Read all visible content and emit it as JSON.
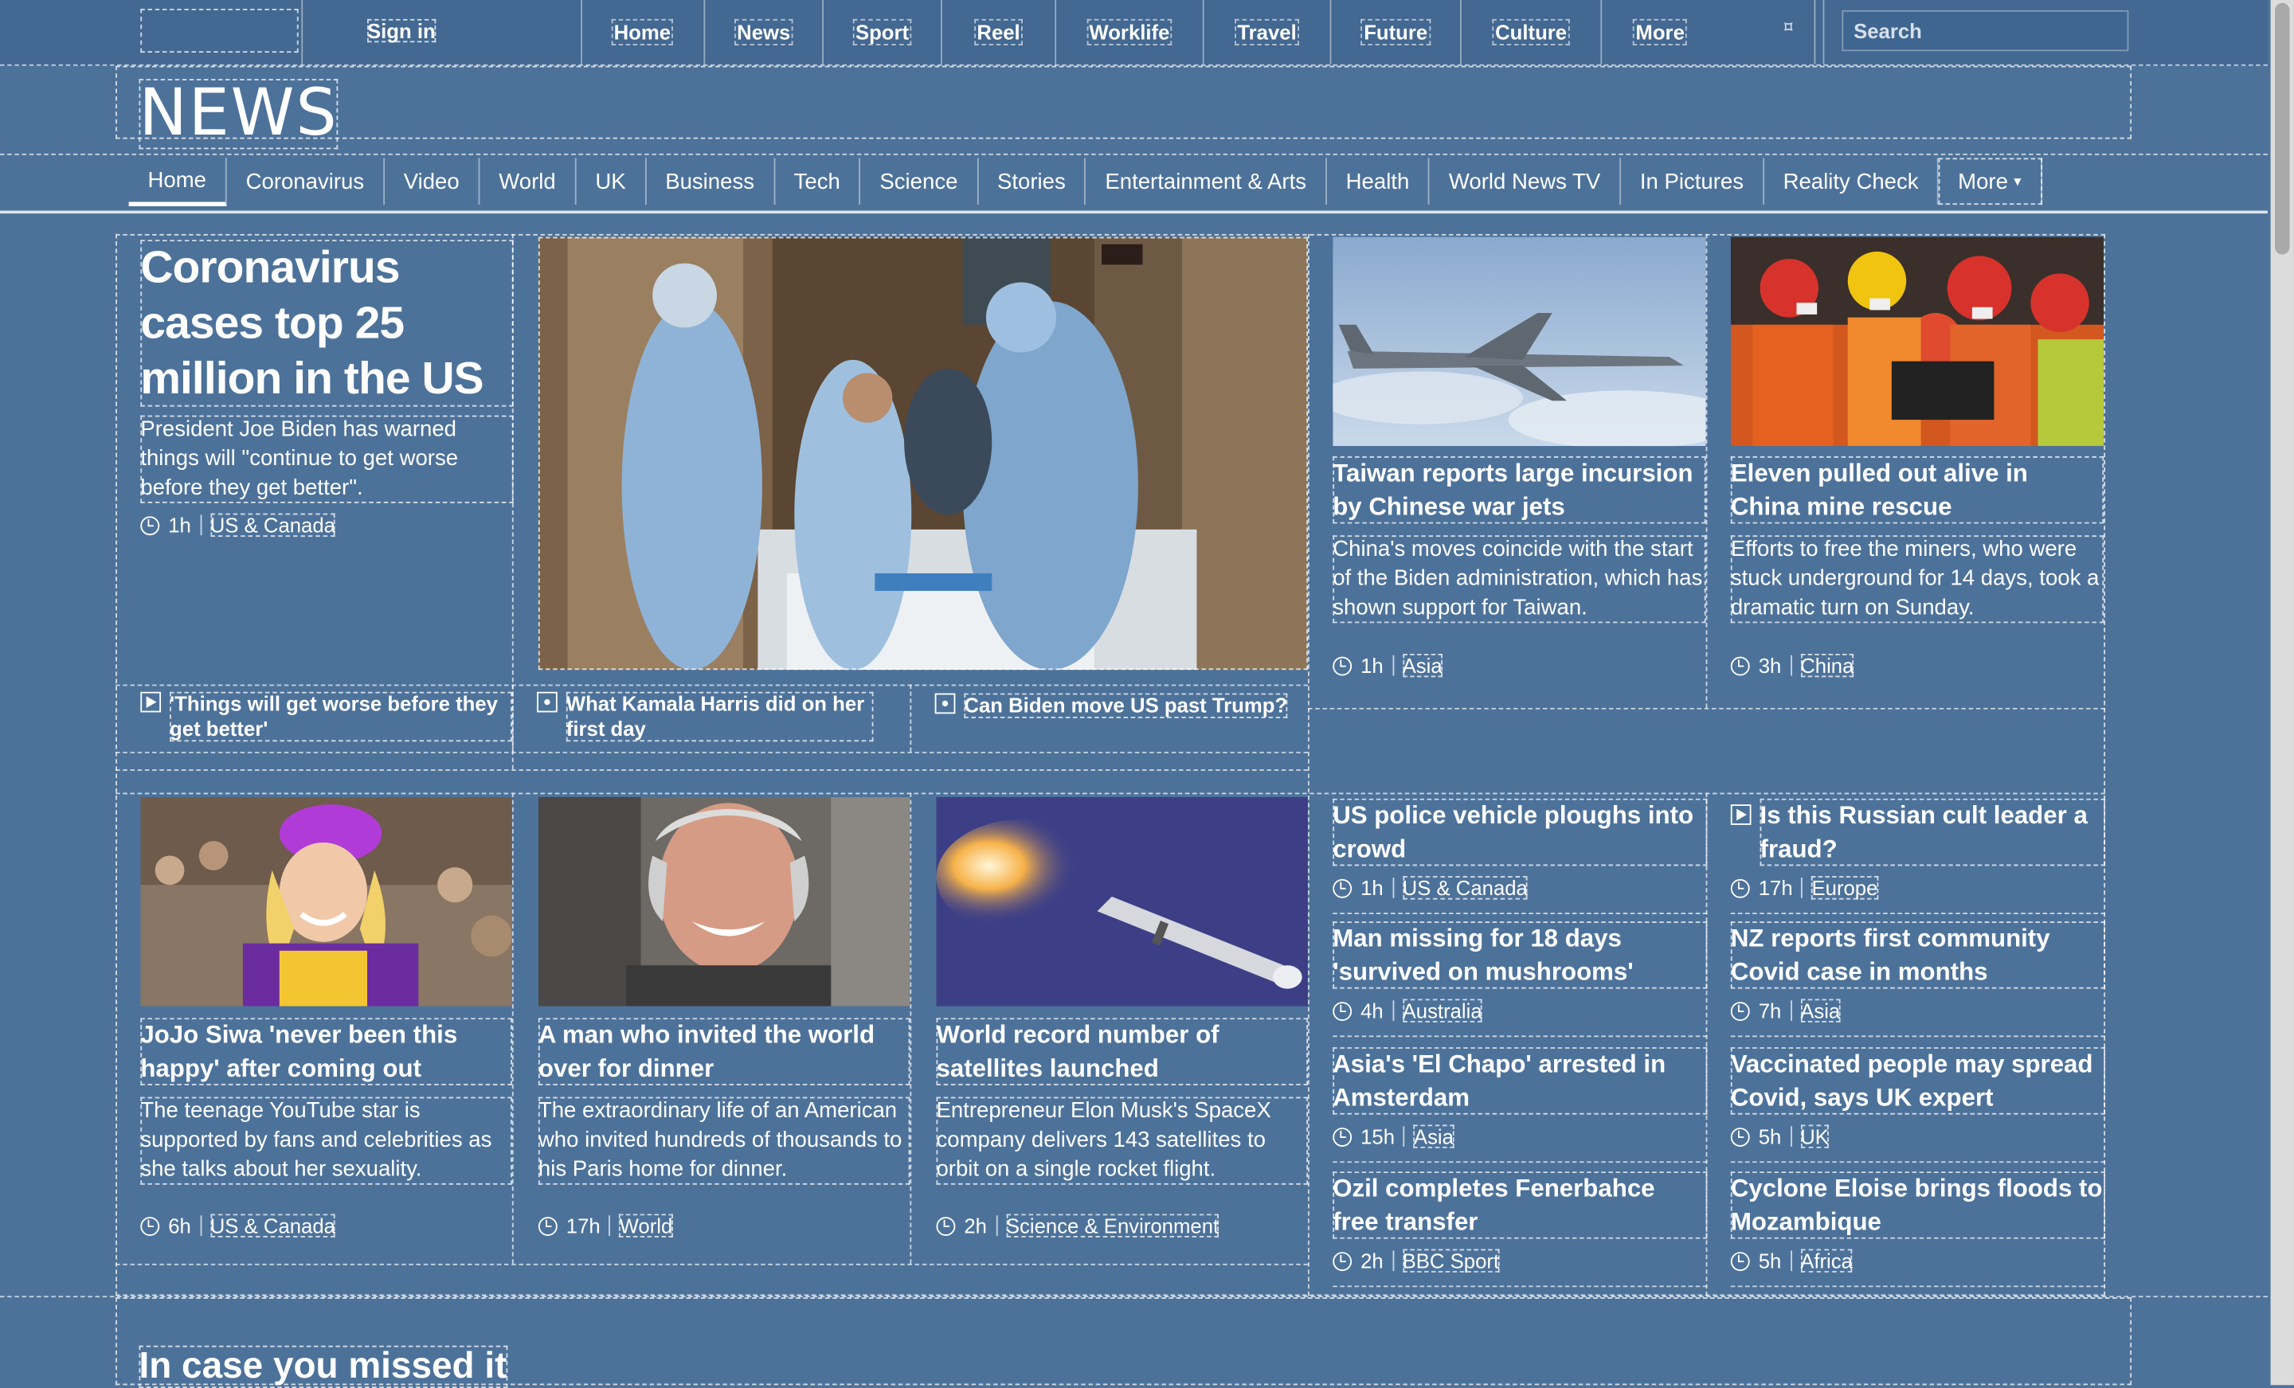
{
  "topbar": {
    "signin_label": "Sign in",
    "nav": [
      {
        "label": "Home",
        "w": 84
      },
      {
        "label": "News",
        "w": 80
      },
      {
        "label": "Sport",
        "w": 80
      },
      {
        "label": "Reel",
        "w": 77
      },
      {
        "label": "Worklife",
        "w": 100
      },
      {
        "label": "Travel",
        "w": 86
      },
      {
        "label": "Future",
        "w": 88
      },
      {
        "label": "Culture",
        "w": 95
      },
      {
        "label": "More",
        "w": 152
      }
    ],
    "search_placeholder": "Search"
  },
  "masthead": {
    "brand": "NEWS"
  },
  "secnav": {
    "items": [
      "Home",
      "Coronavirus",
      "Video",
      "World",
      "UK",
      "Business",
      "Tech",
      "Science",
      "Stories",
      "Entertainment & Arts",
      "Health",
      "World News TV",
      "In Pictures",
      "Reality Check"
    ],
    "more_label": "More"
  },
  "lead": {
    "title": "Coronavirus cases top 25 million in the US",
    "summary": "President Joe Biden has warned things will \"continue to get worse before they get better\".",
    "time": "1h",
    "section": "US & Canada",
    "related": [
      {
        "icon": "play-icon",
        "text": "'Things will get worse before they get better'"
      },
      {
        "icon": "article-icon",
        "text": "What Kamala Harris did on her first day"
      },
      {
        "icon": "article-icon",
        "text": "Can Biden move US past Trump?"
      }
    ]
  },
  "top_right": [
    {
      "title": "Taiwan reports large incursion by Chinese war jets",
      "summary": "China's moves coincide with the start of the Biden administration, which has shown support for Taiwan.",
      "time": "1h",
      "section": "Asia"
    },
    {
      "title": "Eleven pulled out alive in China mine rescue",
      "summary": "Efforts to free the miners, who were stuck underground for 14 days, took a dramatic turn on Sunday.",
      "time": "3h",
      "section": "China"
    }
  ],
  "mid": [
    {
      "title": "JoJo Siwa 'never been this happy' after coming out",
      "summary": "The teenage YouTube star is supported by fans and celebrities as she talks about her sexuality.",
      "time": "6h",
      "section": "US & Canada"
    },
    {
      "title": "A man who invited the world over for dinner",
      "summary": "The extraordinary life of an American who invited hundreds of thousands to his Paris home for dinner.",
      "time": "17h",
      "section": "World"
    },
    {
      "title": "World record number of satellites launched",
      "summary": "Entrepreneur Elon Musk's SpaceX company delivers 143 satellites to orbit on a single rocket flight.",
      "time": "2h",
      "section": "Science & Environment"
    }
  ],
  "small": [
    {
      "title": "US police vehicle ploughs into crowd",
      "time": "1h",
      "section": "US & Canada",
      "video": false
    },
    {
      "title": "Is this Russian cult leader a fraud?",
      "time": "17h",
      "section": "Europe",
      "video": true
    },
    {
      "title": "Man missing for 18 days 'survived on mushrooms'",
      "time": "4h",
      "section": "Australia",
      "video": false
    },
    {
      "title": "NZ reports first community Covid case in months",
      "time": "7h",
      "section": "Asia",
      "video": false
    },
    {
      "title": "Asia's 'El Chapo' arrested in Amsterdam",
      "time": "15h",
      "section": "Asia",
      "video": false
    },
    {
      "title": "Vaccinated people may spread Covid, says UK expert",
      "time": "5h",
      "section": "UK",
      "video": false
    },
    {
      "title": "Ozil completes Fenerbahce free transfer",
      "time": "2h",
      "section": "BBC Sport",
      "video": false
    },
    {
      "title": "Cyclone Eloise brings floods to Mozambique",
      "time": "5h",
      "section": "Africa",
      "video": false
    }
  ],
  "section_heading": "In case you missed it",
  "colors": {
    "background": "#4d729a",
    "topbar": "#436891",
    "text": "#ffffff"
  }
}
